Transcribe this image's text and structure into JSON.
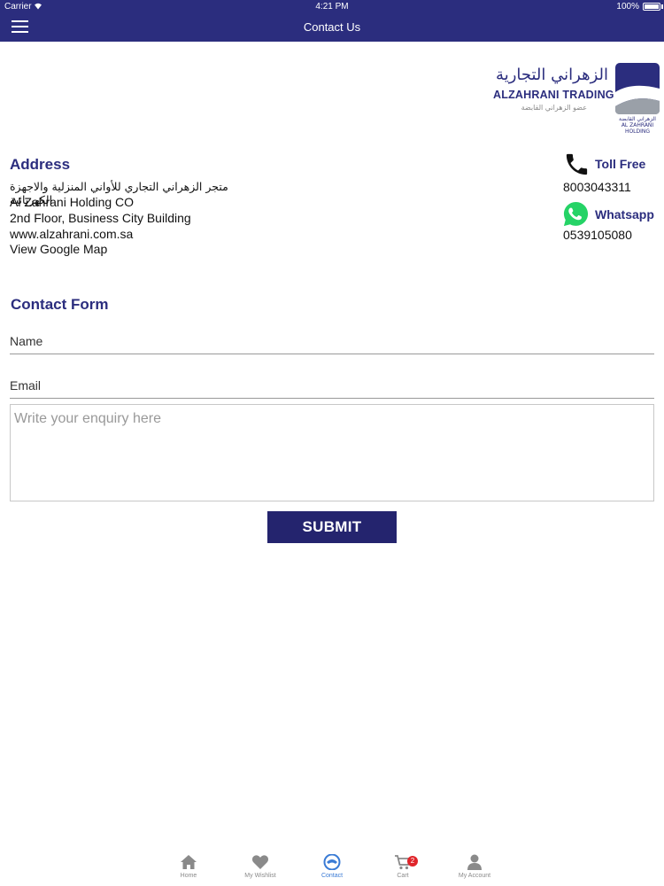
{
  "status_bar": {
    "carrier": "Carrier",
    "time": "4:21 PM",
    "battery": "100%"
  },
  "nav": {
    "title": "Contact Us",
    "menu_icon": "hamburger-menu-icon"
  },
  "logo": {
    "arabic_name": "الزهراني التجارية",
    "english_name": "ALZAHRANI TRADING",
    "arabic_subtitle": "عضو الزهراني القابضة",
    "mark_caption_ar": "الزهراني القابضة",
    "mark_caption_en": "AL ZAHRANI HOLDING",
    "brand_color": "#2b2d7e"
  },
  "address": {
    "title": "Address",
    "line_ar": "متجر الزهراني التجاري للأواني المنزلية والاجهزة الكهربائية",
    "line1": "Al Zahrani Holding CO",
    "line2": "2nd Floor, Business City Building",
    "website": "www.alzahrani.com.sa",
    "map_link": " View Google Map"
  },
  "contacts": {
    "toll_free_label": "Toll Free",
    "toll_free_number": "8003043311",
    "toll_free_icon": "phone-icon",
    "whatsapp_label": "Whatsapp",
    "whatsapp_number": "0539105080",
    "whatsapp_icon": "whatsapp-icon",
    "whatsapp_color": "#25d366"
  },
  "form": {
    "title": "Contact Form",
    "name_placeholder": "Name",
    "email_placeholder": "Email",
    "enquiry_placeholder": "Write your enquiry here",
    "submit_label": "SUBMIT"
  },
  "tabs": [
    {
      "label": "Home",
      "icon": "home-icon"
    },
    {
      "label": "My Wishlist",
      "icon": "heart-icon"
    },
    {
      "label": "Contact",
      "icon": "contact-icon",
      "active": true
    },
    {
      "label": "Cart",
      "icon": "cart-icon",
      "badge": "2"
    },
    {
      "label": "My Account",
      "icon": "user-icon"
    }
  ],
  "colors": {
    "header": "#2b2d7e",
    "accent_text": "#2b2d7e",
    "submit_bg": "#24246e",
    "active_tab": "#3a7bd5",
    "badge": "#e0242a"
  }
}
